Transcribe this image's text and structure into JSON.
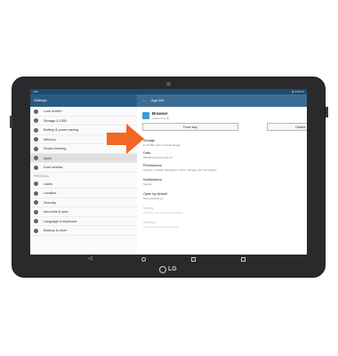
{
  "status": {
    "left": "4:58",
    "right": "▮ 4:58 PM"
  },
  "left_header": {
    "title": "Settings"
  },
  "right_header": {
    "back_glyph": "←",
    "title": "App info"
  },
  "sidebar": {
    "items_top": [
      {
        "label": "Lock screen",
        "icon": "lock-icon"
      },
      {
        "label": "Storage & USB",
        "icon": "storage-icon"
      },
      {
        "label": "Battery & power saving",
        "icon": "battery-icon"
      },
      {
        "label": "Memory",
        "icon": "memory-icon"
      },
      {
        "label": "Smart cleaning",
        "icon": "cleaning-icon"
      },
      {
        "label": "Apps",
        "icon": "apps-icon",
        "active": true
      },
      {
        "label": "Dual window",
        "icon": "dual-window-icon"
      }
    ],
    "section_personal": "PERSONAL",
    "items_personal": [
      {
        "label": "Users",
        "icon": "users-icon"
      },
      {
        "label": "Location",
        "icon": "location-icon"
      },
      {
        "label": "Security",
        "icon": "security-icon"
      },
      {
        "label": "Accounts & sync",
        "icon": "accounts-icon"
      },
      {
        "label": "Language & keyboard",
        "icon": "language-icon"
      },
      {
        "label": "Backup & reset",
        "icon": "backup-icon"
      }
    ]
  },
  "app": {
    "name": "Browser",
    "version": "version 6.0.16",
    "force_stop_label": "Force stop",
    "disable_label": "Disable"
  },
  "details": [
    {
      "title": "Storage",
      "sub": "13.29 MB used in internal storage",
      "dim": false
    },
    {
      "title": "Data",
      "sub": "566 kB used since May 21",
      "dim": false
    },
    {
      "title": "Permissions",
      "sub": "Camera, Contacts, Microphone, Phone, Storage, and Your location",
      "dim": false
    },
    {
      "title": "Notifications",
      "sub": "Normal",
      "dim": false
    },
    {
      "title": "Open by default",
      "sub": "Some defaults set",
      "dim": false
    },
    {
      "title": "Battery",
      "sub": "No battery use since last full charge",
      "dim": true
    },
    {
      "title": "Memory",
      "sub": "No memory used in last 3 hours",
      "dim": true
    }
  ],
  "brand": {
    "text": "LG"
  },
  "colors": {
    "arrow": "#f26722",
    "header_left": "#2b5b81",
    "header_right": "#3d6d93"
  }
}
